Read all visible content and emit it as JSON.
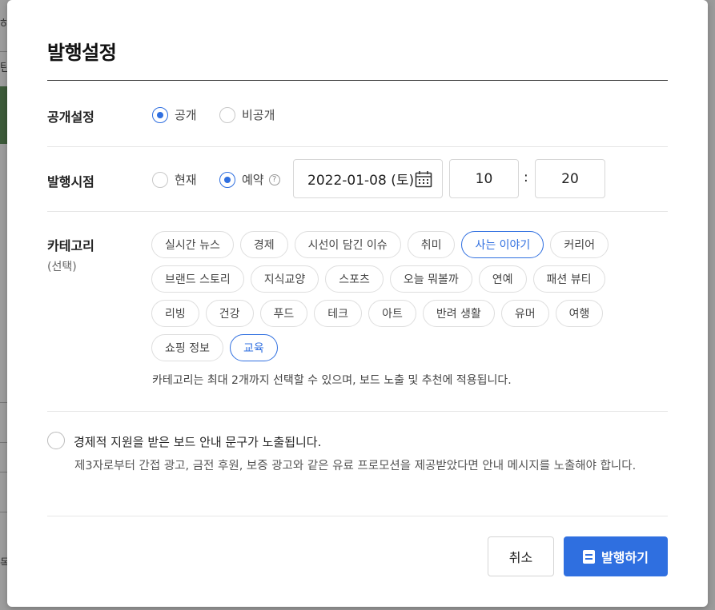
{
  "background": {
    "edge_chars": [
      "하",
      "탄",
      "목"
    ]
  },
  "modal": {
    "title": "발행설정",
    "visibility": {
      "label": "공개설정",
      "options": [
        {
          "label": "공개",
          "selected": true
        },
        {
          "label": "비공개",
          "selected": false
        }
      ]
    },
    "publish_time": {
      "label": "발행시점",
      "options": [
        {
          "label": "현재",
          "selected": false
        },
        {
          "label": "예약",
          "selected": true
        }
      ],
      "help_icon": "question-circle-icon",
      "date": "2022-01-08 (토)",
      "hour": "10",
      "colon": ":",
      "minute": "20"
    },
    "category": {
      "label": "카테고리",
      "sub_label": "(선택)",
      "chips": [
        {
          "label": "실시간 뉴스",
          "selected": false
        },
        {
          "label": "경제",
          "selected": false
        },
        {
          "label": "시선이 담긴 이슈",
          "selected": false
        },
        {
          "label": "취미",
          "selected": false
        },
        {
          "label": "사는 이야기",
          "selected": true
        },
        {
          "label": "커리어",
          "selected": false
        },
        {
          "label": "브랜드 스토리",
          "selected": false
        },
        {
          "label": "지식교양",
          "selected": false
        },
        {
          "label": "스포츠",
          "selected": false
        },
        {
          "label": "오늘 뭐볼까",
          "selected": false
        },
        {
          "label": "연예",
          "selected": false
        },
        {
          "label": "패션 뷰티",
          "selected": false
        },
        {
          "label": "리빙",
          "selected": false
        },
        {
          "label": "건강",
          "selected": false
        },
        {
          "label": "푸드",
          "selected": false
        },
        {
          "label": "테크",
          "selected": false
        },
        {
          "label": "아트",
          "selected": false
        },
        {
          "label": "반려 생활",
          "selected": false
        },
        {
          "label": "유머",
          "selected": false
        },
        {
          "label": "여행",
          "selected": false
        },
        {
          "label": "쇼핑 정보",
          "selected": false
        },
        {
          "label": "교육",
          "selected": true
        }
      ],
      "note": "카테고리는 최대 2개까지 선택할 수 있으며, 보드 노출 및 추천에 적용됩니다."
    },
    "sponsorship": {
      "checked": false,
      "title": "경제적 지원을 받은 보드 안내 문구가 노출됩니다.",
      "description": "제3자로부터 간접 광고, 금전 후원, 보증 광고와 같은 유료 프로모션을 제공받았다면 안내 메시지를 노출해야 합니다."
    },
    "buttons": {
      "cancel": "취소",
      "publish": "발행하기"
    },
    "accent_color": "#2f6fe0"
  }
}
